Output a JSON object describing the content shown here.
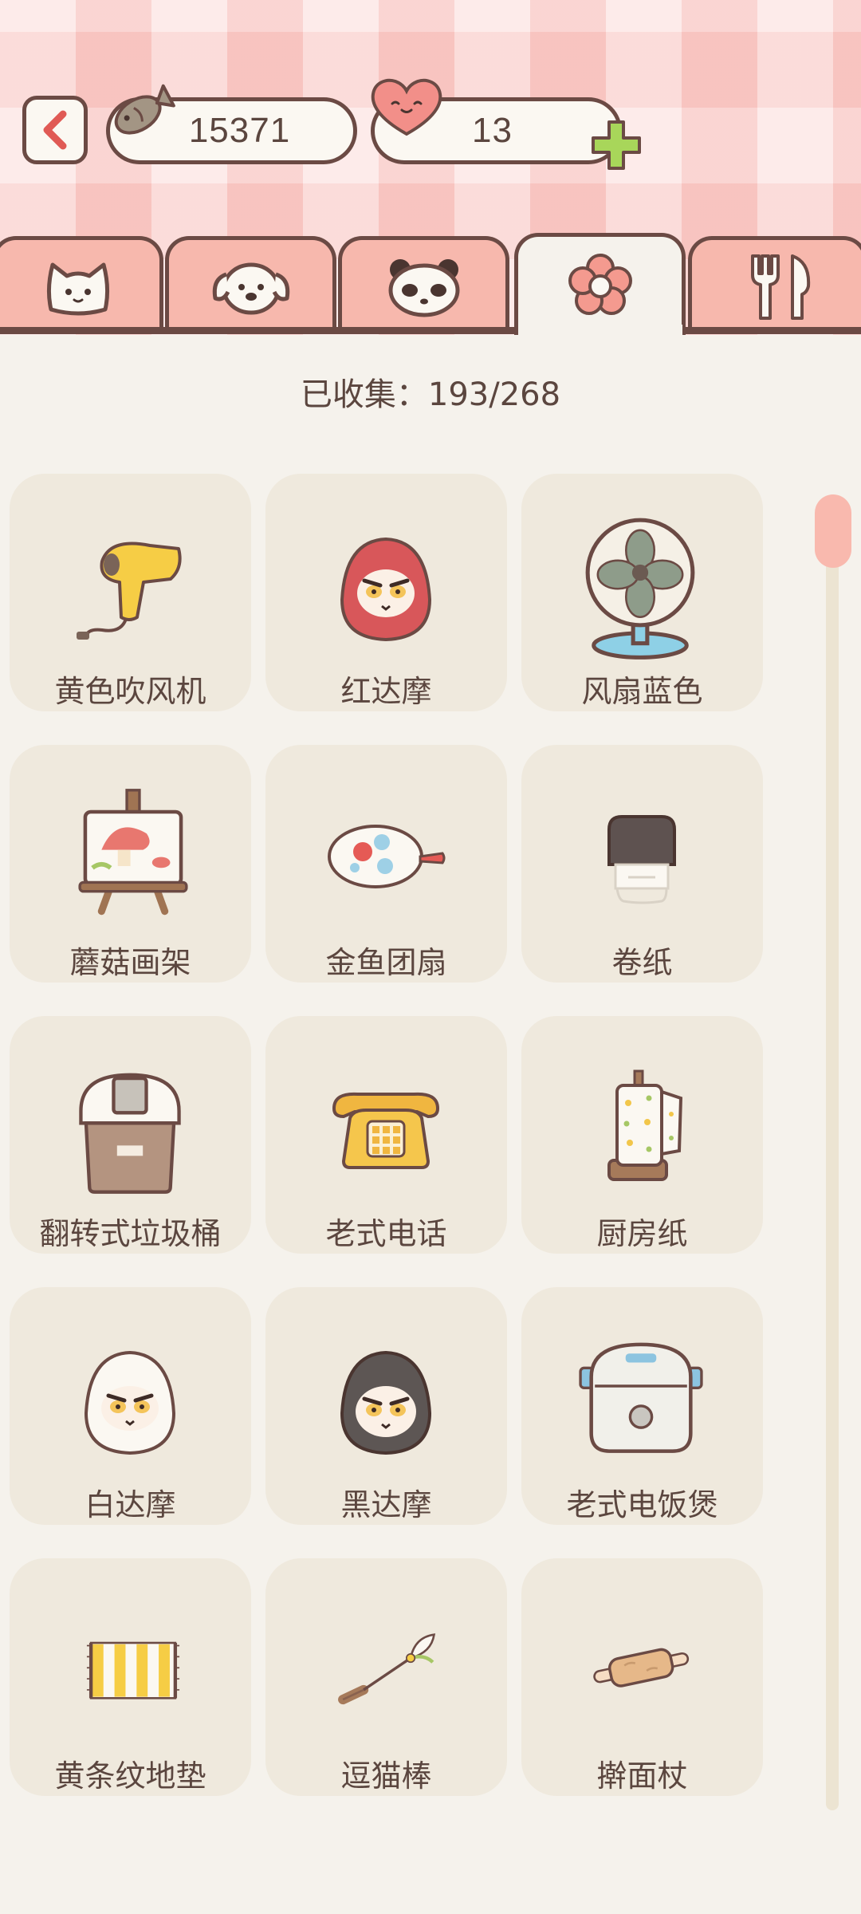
{
  "header": {
    "fish_count": "15371",
    "heart_count": "13"
  },
  "icons": {
    "back": "back-arrow-icon",
    "fish": "fish-currency-icon",
    "heart": "heart-currency-icon",
    "plus": "plus-icon"
  },
  "tabs": [
    {
      "icon": "cat-icon",
      "active": false
    },
    {
      "icon": "dog-icon",
      "active": false
    },
    {
      "icon": "panda-icon",
      "active": false
    },
    {
      "icon": "flower-icon",
      "active": true
    },
    {
      "icon": "fork-knife-icon",
      "active": false
    }
  ],
  "collection": {
    "label": "已收集：193/268"
  },
  "items": [
    {
      "name": "黄色吹风机",
      "icon": "hair-dryer-icon"
    },
    {
      "name": "红达摩",
      "icon": "red-daruma-icon"
    },
    {
      "name": "风扇蓝色",
      "icon": "blue-fan-icon"
    },
    {
      "name": "蘑菇画架",
      "icon": "mushroom-easel-icon"
    },
    {
      "name": "金鱼团扇",
      "icon": "goldfish-fan-icon"
    },
    {
      "name": "卷纸",
      "icon": "toilet-paper-icon"
    },
    {
      "name": "翻转式垃圾桶",
      "icon": "trash-bin-icon"
    },
    {
      "name": "老式电话",
      "icon": "old-phone-icon"
    },
    {
      "name": "厨房纸",
      "icon": "kitchen-paper-icon"
    },
    {
      "name": "白达摩",
      "icon": "white-daruma-icon"
    },
    {
      "name": "黑达摩",
      "icon": "black-daruma-icon"
    },
    {
      "name": "老式电饭煲",
      "icon": "rice-cooker-icon"
    },
    {
      "name": "黄条纹地垫",
      "icon": "striped-mat-icon"
    },
    {
      "name": "逗猫棒",
      "icon": "cat-teaser-icon"
    },
    {
      "name": "擀面杖",
      "icon": "rolling-pin-icon"
    }
  ],
  "colors": {
    "outline": "#6b4a44",
    "header_pink": "#fbd6d3",
    "tab_pink": "#f7b8ad",
    "card_bg": "#efe9dd",
    "page_bg": "#f5f2ec",
    "plus_green": "#a8d65a",
    "scroll_thumb": "#f9b9ae"
  }
}
